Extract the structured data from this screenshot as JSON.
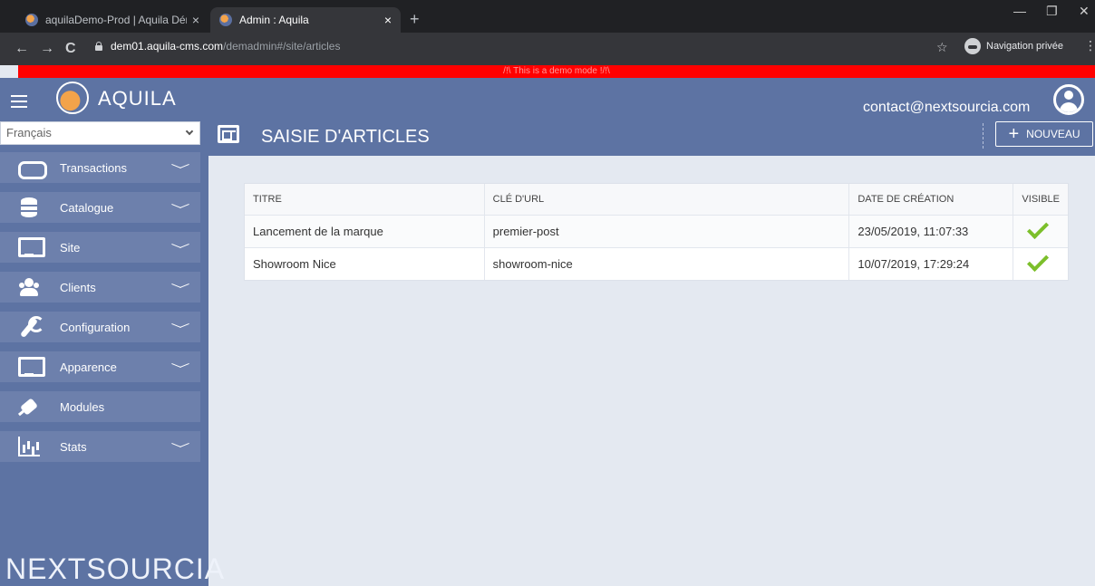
{
  "browser": {
    "tabs": [
      {
        "title": "aquilaDemo-Prod | Aquila Démo"
      },
      {
        "title": "Admin : Aquila"
      }
    ],
    "url_host": "dem01.aquila-cms.com",
    "url_path": "/demadmin#/site/articles",
    "incognito_label": "Navigation privée"
  },
  "demo_banner": "/!\\ This is a demo mode !/!\\",
  "header": {
    "brand": "AQUILA",
    "account_email": "contact@nextsourcia.com"
  },
  "sidebar": {
    "language": "Français",
    "items": [
      {
        "label": "Transactions",
        "icon": "handshake-icon"
      },
      {
        "label": "Catalogue",
        "icon": "database-icon"
      },
      {
        "label": "Site",
        "icon": "monitor-icon"
      },
      {
        "label": "Clients",
        "icon": "users-icon"
      },
      {
        "label": "Configuration",
        "icon": "wrench-icon"
      },
      {
        "label": "Apparence",
        "icon": "monitor-icon"
      },
      {
        "label": "Modules",
        "icon": "plug-icon"
      },
      {
        "label": "Stats",
        "icon": "bar-chart-icon"
      }
    ],
    "footer_logo": "NEXTSOURCIA"
  },
  "page": {
    "title": "SAISIE D'ARTICLES",
    "new_button": "NOUVEAU"
  },
  "table": {
    "columns": [
      "TITRE",
      "CLÉ D'URL",
      "DATE DE CRÉATION",
      "VISIBLE"
    ],
    "rows": [
      {
        "title": "Lancement de la marque",
        "slug": "premier-post",
        "date": "23/05/2019, 11:07:33",
        "visible": true
      },
      {
        "title": "Showroom Nice",
        "slug": "showroom-nice",
        "date": "10/07/2019, 17:29:24",
        "visible": true
      }
    ]
  },
  "colors": {
    "primary": "#5d73a3",
    "sidebar_item": "#6d80ac",
    "demo_banner": "#ff0000",
    "check": "#7cbf2b"
  }
}
